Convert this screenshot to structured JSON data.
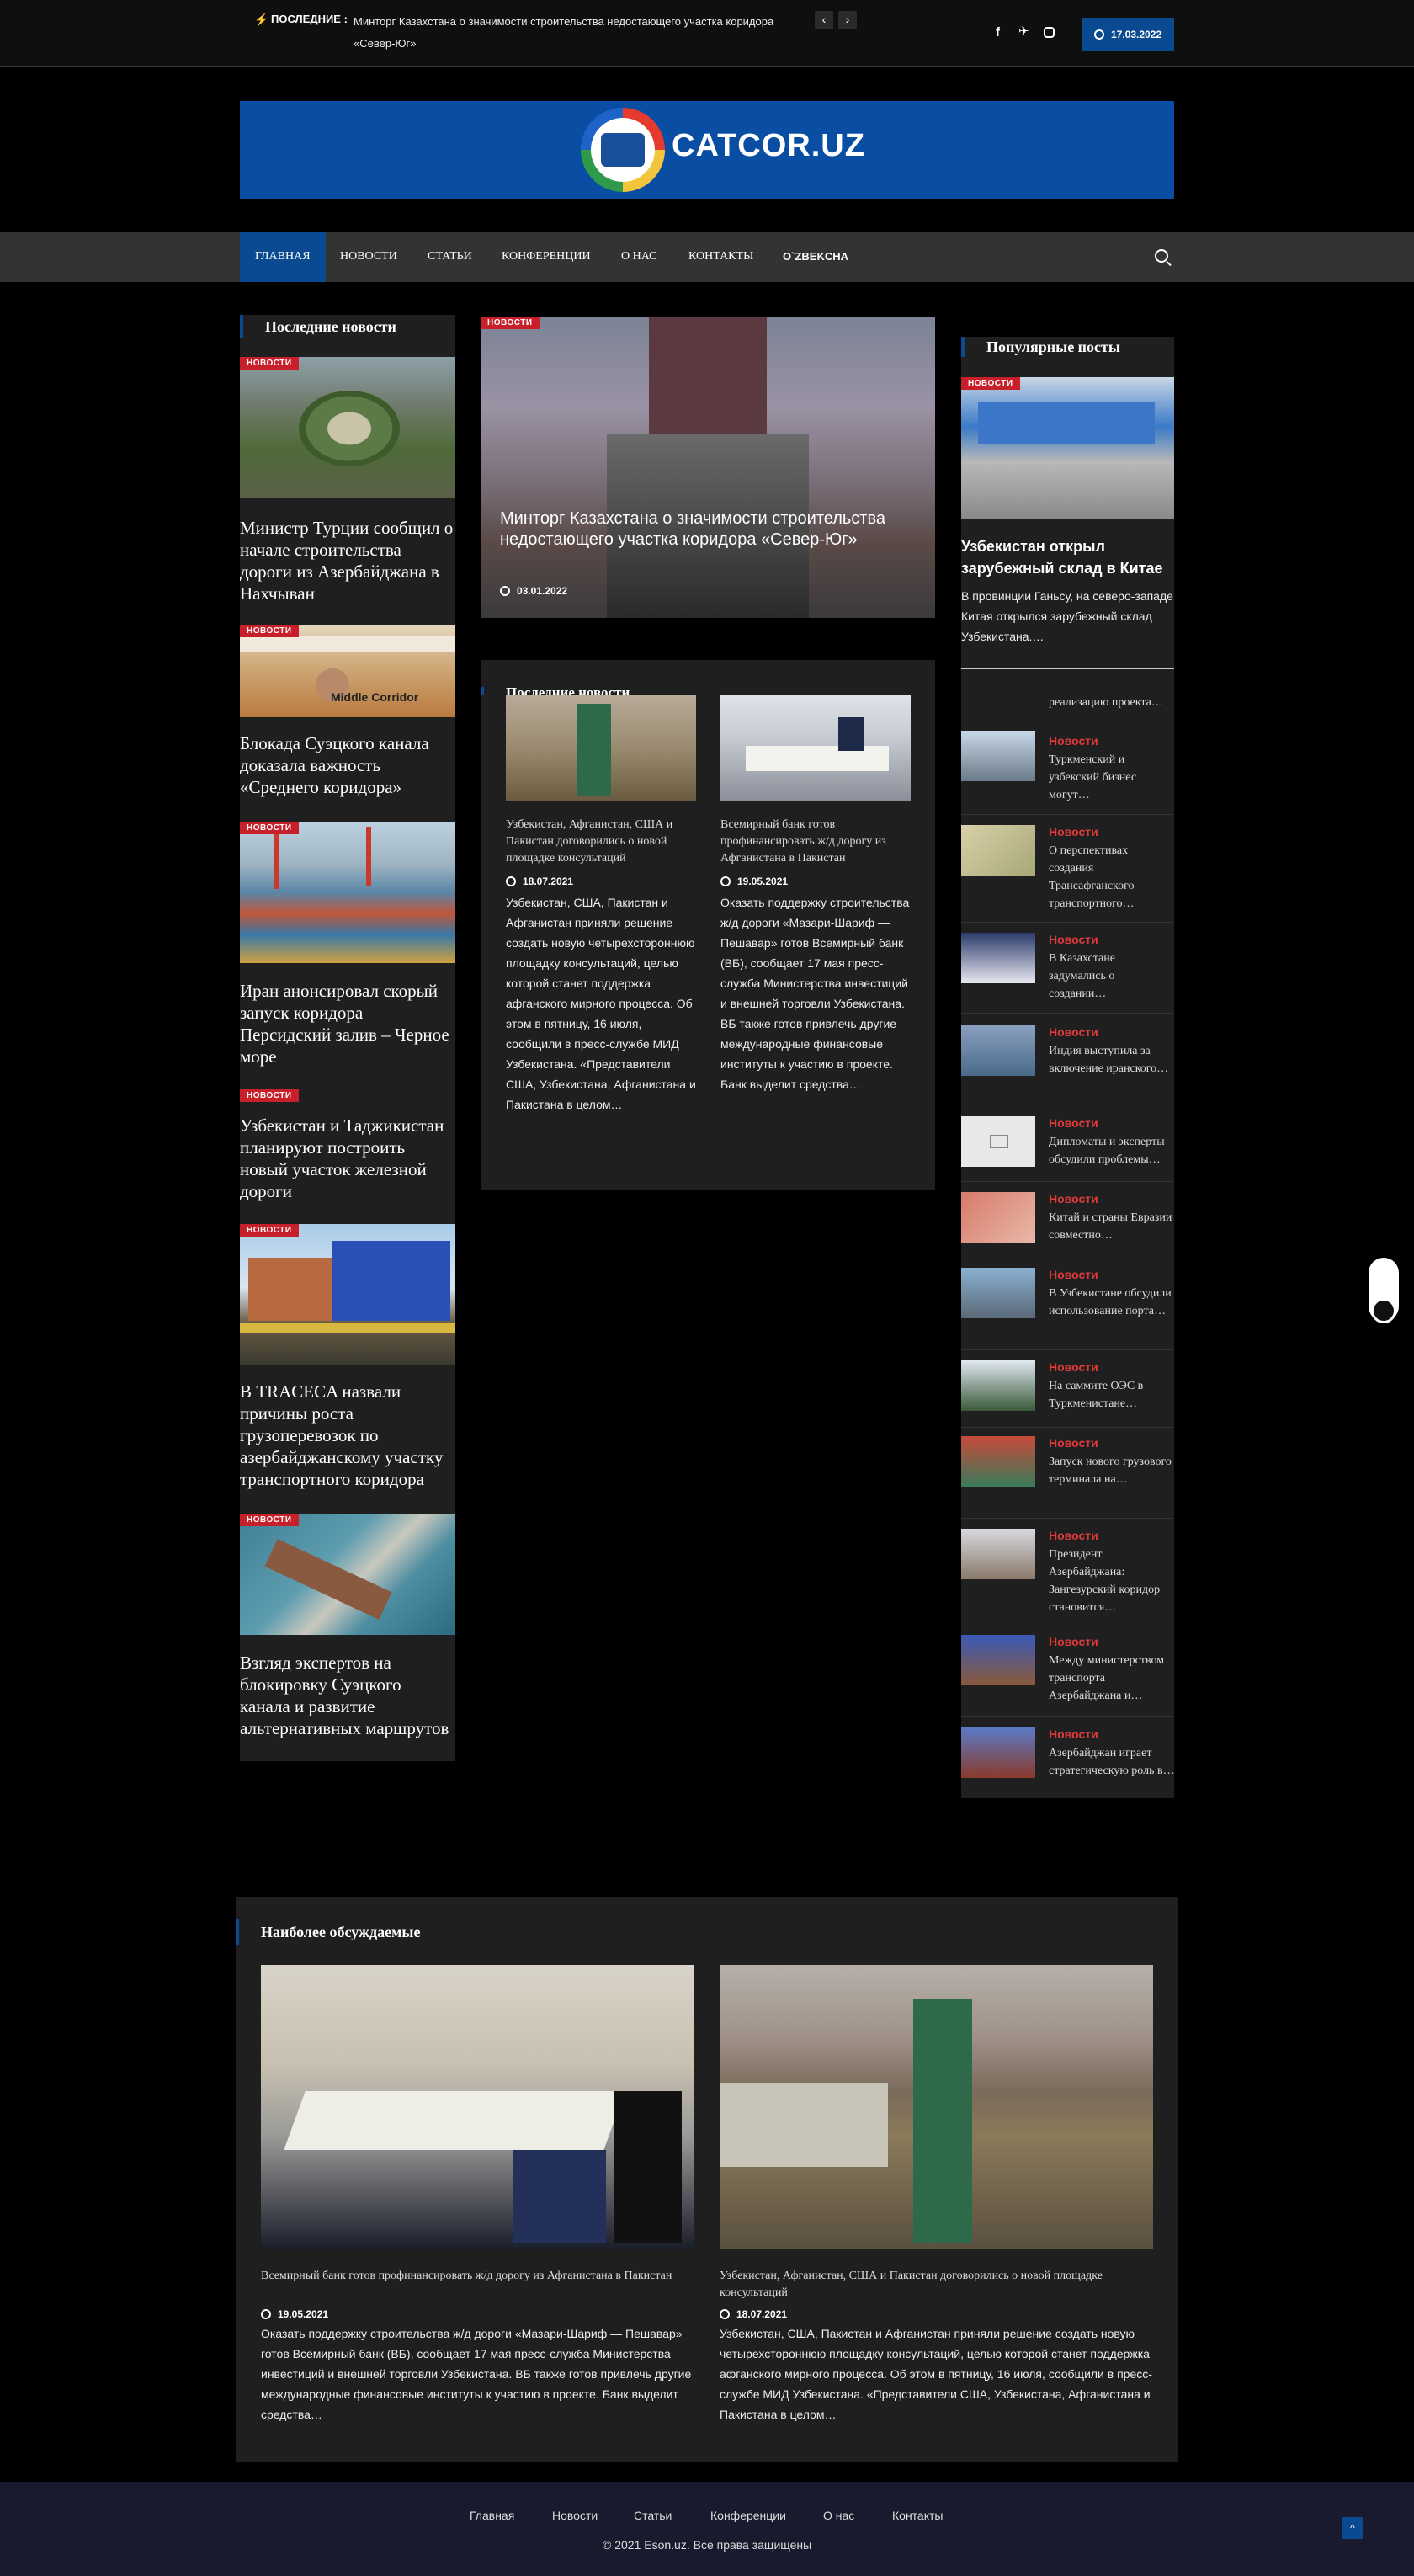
{
  "topbar": {
    "label": "ПОСЛЕДНИЕ :",
    "ticker": "Минторг Казахстана о значимости строительства недостающего участка коридора «Север-Юг»",
    "prev": "‹",
    "next": "›",
    "date": "17.03.2022"
  },
  "logo": {
    "text": "CATCOR.UZ"
  },
  "nav": {
    "items": [
      "Главная",
      "Новости",
      "Статьи",
      "Конференции",
      "О нас",
      "Контакты",
      "O`zbekcha"
    ]
  },
  "latest": {
    "title": "Последние новости",
    "badge": "НОВОСТИ",
    "items": [
      "Министр Турции сообщил о начале строительства дороги из Азербайджана в Нахчыван",
      "Блокада Суэцкого канала доказала важность «Среднего коридора»",
      "Иран анонсировал скорый запуск коридора Персидский залив – Черное море",
      "Узбекистан и Таджикистан планируют построить новый участок железной дороги",
      "В TRACECA назвали причины роста грузоперевозок по азербайджанскому участку транспортного коридора",
      "Взгляд экспертов на блокировку Суэцкого канала и развитие альтернативных маршрутов"
    ],
    "image_caption": "Middle Corridor"
  },
  "featured": {
    "badge": "НОВОСТИ",
    "title": "Минторг Казахстана о значимости строительства недостающего участка коридора «Север-Юг»",
    "date": "03.01.2022"
  },
  "middle": {
    "title": "Последние новости",
    "cards": [
      {
        "title": "Узбекистан, Афганистан, США и Пакистан договорились о новой площадке консультаций",
        "date": "18.07.2021",
        "text": "Узбекистан, США, Пакистан и Афганистан приняли решение создать новую четырехстороннюю площадку консультаций, целью которой станет поддержка афганского мирного процесса. Об этом в пятницу, 16 июля, сообщили в пресс-службе МИД Узбекистана. «Представители США, Узбекистана, Афганистана и Пакистана в целом…"
      },
      {
        "title": "Всемирный банк готов профинансировать ж/д дорогу из Афганистана в Пакистан",
        "date": "19.05.2021",
        "text": "Оказать поддержку строительства ж/д дороги «Мазари-Шариф — Пешавар» готов Всемирный банк (ВБ), сообщает 17 мая пресс-служба Министерства инвестиций и внешней торговли Узбекистана. ВБ также готов привлечь другие международные финансовые институты к участию в проекте. Банк выделит средства…"
      }
    ]
  },
  "popular": {
    "title": "Популярные посты",
    "badge": "НОВОСТИ",
    "main_title": "Узбекистан открыл зарубежный склад в Китае",
    "main_text": "В провинции Ганьсу, на северо-западе Китая открылся зарубежный склад Узбекистана.…",
    "partial": "реализацию проекта…",
    "category": "Новости",
    "items": [
      "Туркменский и узбекский бизнес могут…",
      "О перспективах создания Трансафганского транспортного…",
      "В Казахстане задумались о создании…",
      "Индия выступила за включение иранского…",
      "Дипломаты и эксперты обсудили проблемы…",
      "Китай и страны Евразии совместно…",
      "В Узбекистане обсудили использование порта…",
      "На саммите ОЭС в Туркменистане…",
      "Запуск нового грузового терминала на…",
      "Президент Азербайджана: Зангезурский коридор становится…",
      "Между министерством транспорта Азербайджана и…",
      "Азербайджан играет стратегическую роль в…"
    ]
  },
  "discussed": {
    "title": "Наиболее обсуждаемые",
    "cards": [
      {
        "title": "Всемирный банк готов профинансировать ж/д дорогу из Афганистана в Пакистан",
        "date": "19.05.2021",
        "text": "Оказать поддержку строительства ж/д дороги «Мазари-Шариф — Пешавар» готов Всемирный банк (ВБ), сообщает 17 мая пресс-служба Министерства инвестиций и внешней торговли Узбекистана. ВБ также готов привлечь другие международные финансовые институты к участию в проекте. Банк выделит средства…"
      },
      {
        "title": "Узбекистан, Афганистан, США и Пакистан договорились о новой площадке консультаций",
        "date": "18.07.2021",
        "text": "Узбекистан, США, Пакистан и Афганистан приняли решение создать новую четырехстороннюю площадку консультаций, целью которой станет поддержка афганского мирного процесса. Об этом в пятницу, 16 июля, сообщили в пресс-службе МИД Узбекистана. «Представители США, Узбекистана, Афганистана и Пакистана в целом…"
      }
    ]
  },
  "footer": {
    "links": [
      "Главная",
      "Новости",
      "Статьи",
      "Конференции",
      "О нас",
      "Контакты"
    ],
    "copyright": "© 2021 Eson.uz. Все права защищены"
  },
  "colors": {
    "accent": "#0a4a91",
    "badge": "#c8202a",
    "category": "#e03a3a"
  }
}
